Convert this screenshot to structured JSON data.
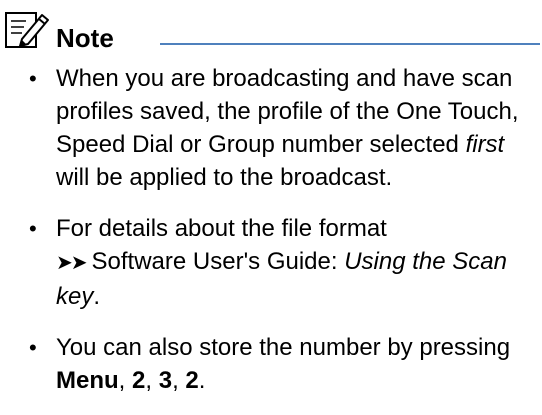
{
  "note": {
    "title": "Note",
    "icon": "pencil-note-icon",
    "rule_color": "#4f81bd"
  },
  "items": [
    {
      "part1": "When you are broadcasting and have scan profiles saved, the profile of the One Touch, Speed Dial or Group number selected ",
      "part2_italic": "first",
      "part3": " will be applied to the broadcast."
    },
    {
      "part1": "For details about the file format",
      "arrow": "➤➤",
      "part2": "Software User's Guide: ",
      "part3_italic": "Using the Scan key",
      "part4": "."
    },
    {
      "part1": "You can also store the number by pressing ",
      "menu_bold": "Menu",
      "sep1": ", ",
      "key1_bold": "2",
      "sep2": ", ",
      "key2_bold": "3",
      "sep3": ", ",
      "key3_bold": "2",
      "end": "."
    }
  ]
}
